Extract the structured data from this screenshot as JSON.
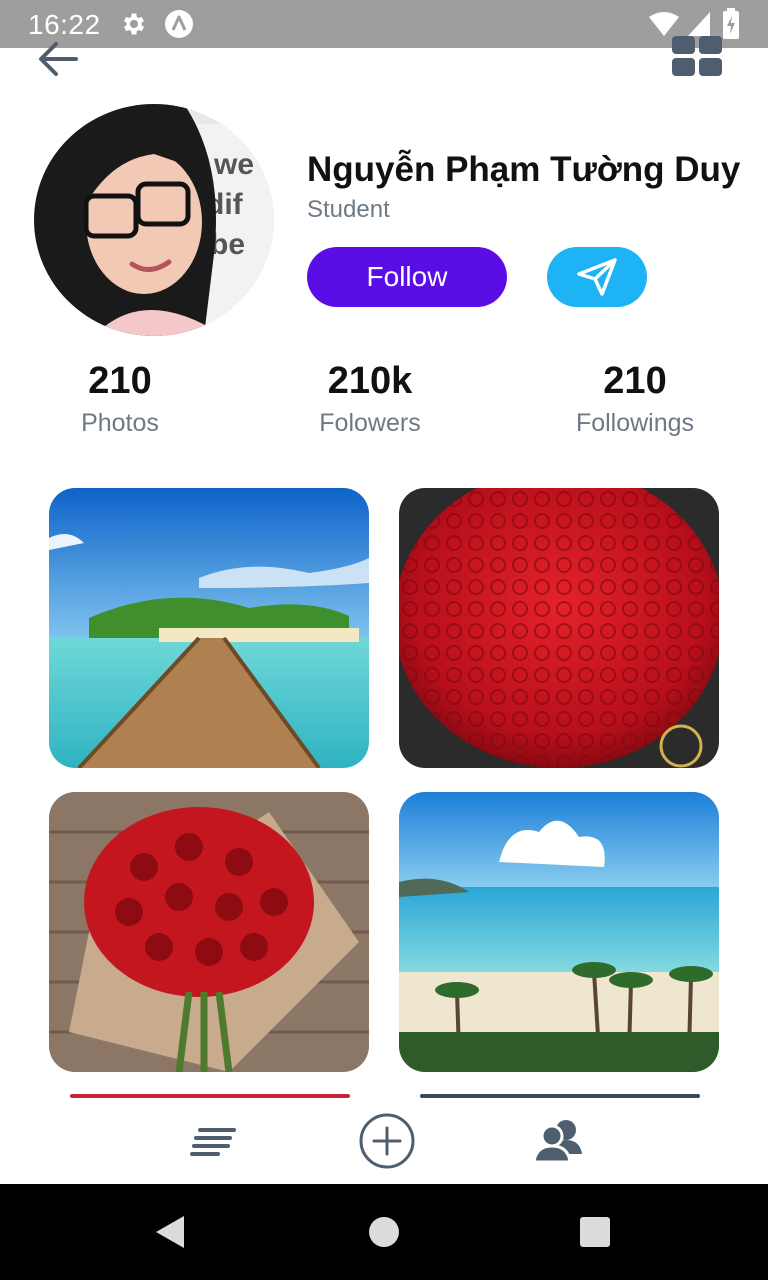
{
  "status_bar": {
    "time": "16:22",
    "icons": [
      "gear-icon",
      "a-icon",
      "wifi-icon",
      "signal-icon",
      "battery-icon"
    ]
  },
  "app_bar": {
    "back_icon": "arrow-left-icon",
    "view_icon": "grid-view-icon"
  },
  "profile": {
    "name": "Nguyễn Phạm Tường Duy",
    "role": "Student",
    "follow_label": "Follow",
    "message_icon": "send-icon"
  },
  "stats": [
    {
      "value": "210",
      "label": "Photos"
    },
    {
      "value": "210k",
      "label": "Folowers"
    },
    {
      "value": "210",
      "label": "Followings"
    }
  ],
  "photos": [
    {
      "subject": "tropical-pier"
    },
    {
      "subject": "red-rose-bouquet-round"
    },
    {
      "subject": "red-rose-bouquet-wrapped"
    },
    {
      "subject": "beach-palms"
    }
  ],
  "bottom_nav": [
    "feed-icon",
    "add-circle-icon",
    "people-icon"
  ],
  "system_nav": [
    "back-triangle-icon",
    "home-circle-icon",
    "recents-square-icon"
  ],
  "colors": {
    "follow_button": "#5b0de6",
    "send_button": "#1eb3f5",
    "status_bar": "#9e9e9e",
    "secondary_text": "#6d7a86",
    "icon_gray": "#4f5e6e"
  }
}
